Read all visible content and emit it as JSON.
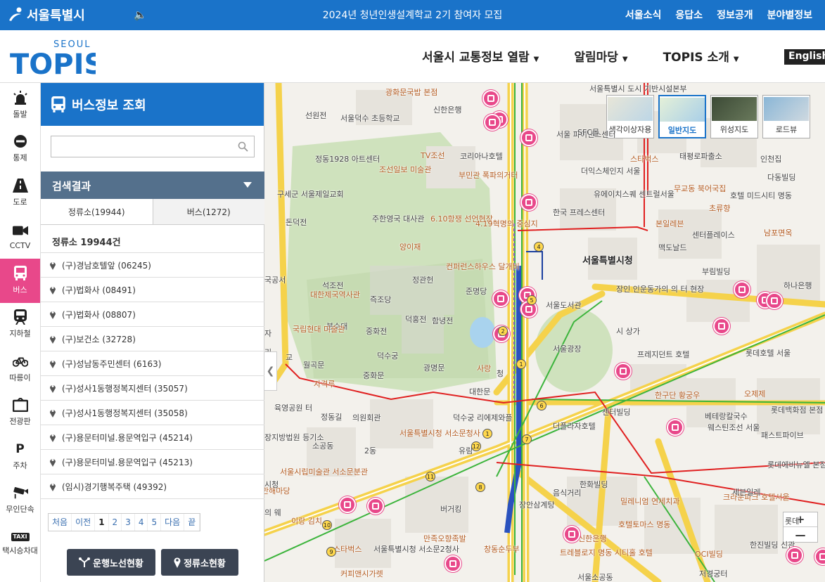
{
  "topbar": {
    "brand": "서울특별시",
    "notice": "2024년 청년인생설계학교 2기 참여자 모집",
    "links": [
      "서울소식",
      "응답소",
      "정보공개",
      "분야별정보"
    ]
  },
  "header": {
    "logo_top": "SEOUL",
    "logo_main": "TOPIS",
    "nav": [
      "서울시 교통정보 열람",
      "알림마당",
      "TOPIS 소개"
    ],
    "english": "English"
  },
  "sidebar": {
    "items": [
      {
        "label": "돌발",
        "icon": "alert-light-icon"
      },
      {
        "label": "통제",
        "icon": "no-entry-icon"
      },
      {
        "label": "도로",
        "icon": "road-icon"
      },
      {
        "label": "CCTV",
        "icon": "video-camera-icon"
      },
      {
        "label": "버스",
        "icon": "bus-icon"
      },
      {
        "label": "지하철",
        "icon": "subway-icon"
      },
      {
        "label": "따릉이",
        "icon": "bicycle-icon"
      },
      {
        "label": "전광판",
        "icon": "signboard-icon"
      },
      {
        "label": "주차",
        "icon": "parking-icon"
      },
      {
        "label": "무인단속",
        "icon": "speed-camera-icon"
      },
      {
        "label": "택시승차대",
        "icon": "taxi-icon"
      }
    ],
    "active_index": 4,
    "taxi_badge": "TAXI",
    "parking_letter": "P"
  },
  "panel": {
    "title": "버스정보 조회",
    "search_placeholder": "",
    "result_title": "검색결과",
    "tabs": [
      "정류소(19944)",
      "버스(1272)"
    ],
    "count_text": "정류소 19944건",
    "stops": [
      "(구)경남호텔앞 (06245)",
      "(구)법화사 (08491)",
      "(구)법화사 (08807)",
      "(구)보건소 (32728)",
      "(구)성남동주민센터 (6163)",
      "(구)성사1동행정복지센터 (35057)",
      "(구)성사1동행정복지센터 (35058)",
      "(구)용문터미널.용문역입구 (45214)",
      "(구)용문터미널.용문역입구 (45213)",
      "(임시)경기행복주택 (49392)"
    ],
    "pager": [
      "처음",
      "이전",
      "1",
      "2",
      "3",
      "4",
      "5",
      "다음",
      "끝"
    ],
    "pager_current": "1",
    "buttons": [
      "운행노선현황",
      "정류소현황"
    ]
  },
  "map": {
    "types": [
      "색각이상자용",
      "일반지도",
      "위성지도",
      "로드뷰"
    ],
    "active_type": "일반지도",
    "zoom_in": "+",
    "zoom_out": "—",
    "colors": {
      "road_yellow": "#f5d24b",
      "route_red": "#e02020",
      "route_green": "#3cb43c",
      "bus_pink": "#e8488a",
      "park": "#c8dcb4",
      "water": "#a9d3ee"
    },
    "labels": [
      "광화문국밥 본점",
      "선원전",
      "서울덕수 초등학교",
      "신한은행",
      "서울 파이낸스센터",
      "SFC몰",
      "서울특별시 도시 기반시설본부",
      "정동1928 아트센터",
      "TV조선",
      "코리아나호텔",
      "조선일보 미술관",
      "부민관 폭파의거터",
      "더익스체인지 서울",
      "유에이치스퀘 센트럴서울",
      "스타벅스",
      "태평로파출소",
      "인천집",
      "다동빌딩",
      "구세군 서울제일교회",
      "주한영국 대사관",
      "6.10항쟁 선언현장",
      "4.19혁명의 중심지",
      "무교동 북어국집",
      "호텔 미드시티 명동",
      "초류향",
      "한국 프레스센터",
      "본일레븐",
      "센터플레이스",
      "남포면옥",
      "돈덕전",
      "양이재",
      "서울특별시청",
      "맥도날드",
      "부림빌딩",
      "컨퍼런스하우스 달개비",
      "석조전",
      "대한제국역사관",
      "준명당",
      "즉조당",
      "정관헌",
      "하나은행",
      "서울도서관",
      "장인 인운동가의 의 터 현장",
      "덕홍전",
      "함녕전",
      "중화전",
      "분수대",
      "국립현대 미술관",
      "덕수궁",
      "서울광장",
      "시 상가",
      "프레지던트 호텔",
      "롯데호텔 서울",
      "사랑",
      "월곡문",
      "중화문",
      "광명문",
      "대한문",
      "자격루",
      "오제제",
      "롯데백화점 본점",
      "한구단 황궁우",
      "센터빌딩",
      "베테랑칼국수",
      "웨스틴조선 서울",
      "패스트파이브",
      "더플라자호텔",
      "정동길",
      "의원회관",
      "소공동",
      "2동",
      "서울특별시청 서소문청사",
      "덕수궁 리에제와플",
      "유림",
      "육영공원 터",
      "장지방법원 등기소",
      "서울시립미술관 서소문분관",
      "만해마당",
      "한화빌딩",
      "롯데에비뉴엘 본점",
      "크라운파크 호텔서울",
      "세븐일레",
      "음식거리",
      "장안삼계탕",
      "밀레니엄 연세치과",
      "호텔토마스 명동",
      "버거킹",
      "신한은행",
      "트레블로지 명동 시티홀 호텔",
      "OCI빌딩",
      "한진빌딩 신관",
      "이랑 김치",
      "스타벅스",
      "서울특별시청 서소문2청사",
      "만족오향족발",
      "창동순두부",
      "커피앤시가렛",
      "서울소공동",
      "저경궁터",
      "시청",
      "국공서",
      "자",
      "리",
      "의 웨",
      "청",
      "교",
      "롯데"
    ]
  }
}
